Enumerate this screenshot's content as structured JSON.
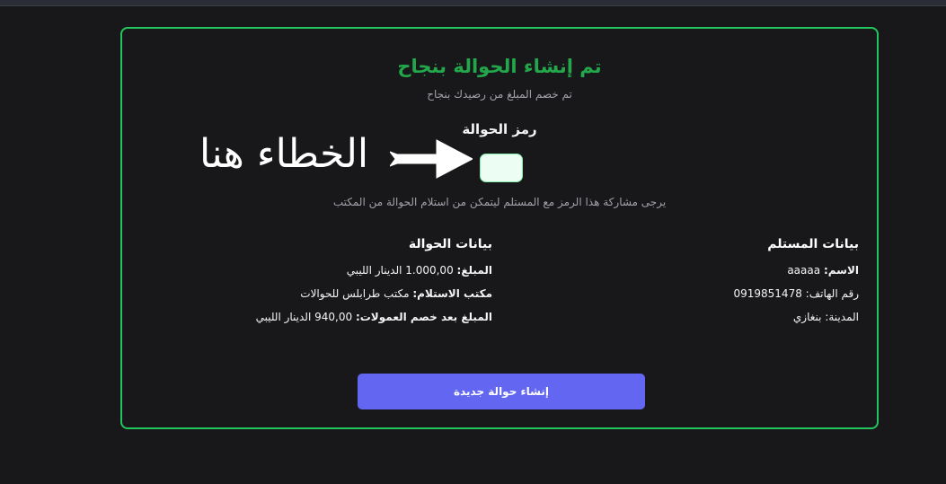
{
  "card": {
    "title": "تم إنشاء الحوالة بنجاح",
    "subtitle": "تم خصم المبلغ من رصيدك بنجاح",
    "code_label": "رمز الحوالة",
    "code_value": "",
    "share_note": "يرجى مشاركة هذا الرمز مع المستلم ليتمكن من استلام الحوالة من المكتب",
    "annotation_text": "الخطاء هنا"
  },
  "recipient": {
    "heading": "بيانات المستلم",
    "name_label": "الاسم:",
    "name_value": "aaaaa",
    "phone_label": "رقم الهاتف:",
    "phone_value": "0919851478",
    "city_label": "المدينة:",
    "city_value": "بنغازي"
  },
  "transfer": {
    "heading": "بيانات الحوالة",
    "amount_label": "المبلغ:",
    "amount_value": "1.000,00 الدينار الليبي",
    "office_label": "مكتب الاستلام:",
    "office_value": "مكتب طرابلس للحوالات",
    "net_label": "المبلغ بعد خصم العمولات:",
    "net_value": "940,00 الدينار الليبي"
  },
  "actions": {
    "new_transfer_label": "إنشاء حوالة جديدة"
  },
  "colors": {
    "success": "#22c55e",
    "accent": "#6366f1",
    "background": "#18181b"
  }
}
